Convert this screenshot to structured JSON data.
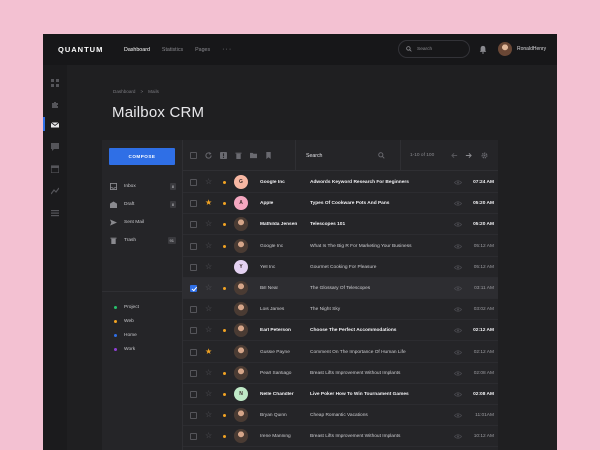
{
  "app": {
    "brand": "QUANTUM"
  },
  "nav": {
    "items": [
      "Dashboard",
      "Statistics",
      "Pages"
    ],
    "more": "···"
  },
  "topsearch": {
    "placeholder": "Search"
  },
  "user": {
    "name": "RonaldHenry"
  },
  "breadcrumb": {
    "parent": "Dashboard",
    "sep": ">",
    "current": "Mails"
  },
  "page": {
    "title": "Mailbox CRM"
  },
  "compose": {
    "label": "COMPOSE"
  },
  "folders": [
    {
      "label": "Inbox",
      "count": "8",
      "icon": "inbox-icon"
    },
    {
      "label": "Draft",
      "count": "8",
      "icon": "draft-icon"
    },
    {
      "label": "Sent Mail",
      "count": "",
      "icon": "send-icon"
    },
    {
      "label": "Trash",
      "count": "91",
      "icon": "trash-icon"
    }
  ],
  "labels": [
    {
      "label": "Project",
      "color": "#27c26c"
    },
    {
      "label": "Web",
      "color": "#f1a323"
    },
    {
      "label": "Home",
      "color": "#2f6fe6"
    },
    {
      "label": "Work",
      "color": "#8f3fd6"
    }
  ],
  "toolbar": {
    "search_label": "Search",
    "pager": "1-10 of 100"
  },
  "colors": {
    "accent": "#2f6fe6",
    "star": "#f1a323",
    "important": "#f1a323"
  },
  "emails": [
    {
      "sender": "Google Inc",
      "subject": "Adwords Keyword Research For Beginners",
      "time": "07:24 AM",
      "unread": true,
      "starred": false,
      "important": true,
      "avatar": "G",
      "avatar_color": "#f7b7a3",
      "photo": false
    },
    {
      "sender": "Apple",
      "subject": "Types Of Cookware Pots And Pans",
      "time": "05:20 AM",
      "unread": true,
      "starred": true,
      "important": true,
      "avatar": "A",
      "avatar_color": "#f4a7c0",
      "photo": false
    },
    {
      "sender": "Mathilda Jensen",
      "subject": "Telescopes 101",
      "time": "05:20 AM",
      "unread": true,
      "starred": false,
      "important": true,
      "avatar": "",
      "avatar_color": "",
      "photo": true
    },
    {
      "sender": "Google Inc",
      "subject": "What Is The Big R For Marketing Your Business",
      "time": "05:12 AM",
      "unread": false,
      "starred": false,
      "important": true,
      "avatar": "",
      "avatar_color": "",
      "photo": true
    },
    {
      "sender": "Yell Inc",
      "subject": "Gourmet Cooking For Pleasure",
      "time": "05:12 AM",
      "unread": false,
      "starred": false,
      "important": false,
      "avatar": "Y",
      "avatar_color": "#e4d2f2",
      "photo": false
    },
    {
      "sender": "Bill Neal",
      "subject": "The Glossary Of Telescopes",
      "time": "03:11 AM",
      "unread": false,
      "starred": false,
      "important": true,
      "avatar": "",
      "avatar_color": "",
      "photo": true,
      "selected": true
    },
    {
      "sender": "Lois James",
      "subject": "The Night Sky",
      "time": "03:02 AM",
      "unread": false,
      "starred": false,
      "important": false,
      "avatar": "",
      "avatar_color": "",
      "photo": true
    },
    {
      "sender": "Earl Peterson",
      "subject": "Choose The Perfect Accommodations",
      "time": "02:12 AM",
      "unread": true,
      "starred": false,
      "important": true,
      "avatar": "",
      "avatar_color": "",
      "photo": true
    },
    {
      "sender": "Gussie Payne",
      "subject": "Comment On The Importance Of Human Life",
      "time": "02:12 AM",
      "unread": false,
      "starred": true,
      "important": false,
      "avatar": "",
      "avatar_color": "",
      "photo": true
    },
    {
      "sender": "Pearl Santiago",
      "subject": "Breast Lifts Improvement Without Implants",
      "time": "02:08 AM",
      "unread": false,
      "starred": false,
      "important": true,
      "avatar": "",
      "avatar_color": "",
      "photo": true
    },
    {
      "sender": "Nelle Chandler",
      "subject": "Live Poker How To Win Tournament Games",
      "time": "02:08 AM",
      "unread": true,
      "starred": false,
      "important": true,
      "avatar": "N",
      "avatar_color": "#bfe9c7",
      "photo": false
    },
    {
      "sender": "Bryan Quinn",
      "subject": "Cheap Romantic Vacations",
      "time": "11:01AM",
      "unread": false,
      "starred": false,
      "important": true,
      "avatar": "",
      "avatar_color": "",
      "photo": true
    },
    {
      "sender": "Irene Manning",
      "subject": "Breast Lifts Improvement Without Implants",
      "time": "10:12 AM",
      "unread": false,
      "starred": false,
      "important": true,
      "avatar": "",
      "avatar_color": "",
      "photo": true
    }
  ]
}
